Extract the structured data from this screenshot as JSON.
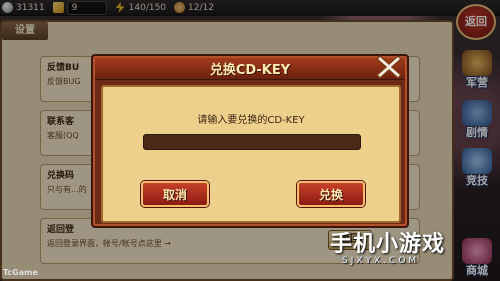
{
  "topbar": {
    "silver": "31311",
    "gold": "9",
    "energy": "140/150",
    "stamina": "12/12"
  },
  "settings": {
    "title": "设置",
    "rows": [
      {
        "title": "反馈BU",
        "desc": "反馈BUG"
      },
      {
        "title": "联系客",
        "desc": "客服(QQ"
      },
      {
        "title": "兑换码",
        "desc": "只与有...的"
      },
      {
        "title": "返回登",
        "desc": "返回登录界面，帐号/帐号点这里 →"
      }
    ],
    "return_label": "返回"
  },
  "side_menu": {
    "back": "返回",
    "items": [
      {
        "label": "军营",
        "color": "#b7742a"
      },
      {
        "label": "剧情",
        "color": "#3b6fb5"
      },
      {
        "label": "竞技",
        "color": "#4a7fc8"
      },
      {
        "label": "商城",
        "color": "#b83a66"
      }
    ]
  },
  "modal": {
    "title": "兑换CD-KEY",
    "prompt": "请输入要兑换的CD-KEY",
    "input_value": "",
    "cancel_label": "取消",
    "redeem_label": "兑换"
  },
  "watermark": {
    "left": "TcGame",
    "site_name": "手机小游戏",
    "site_url": "SJXYX.COM"
  }
}
